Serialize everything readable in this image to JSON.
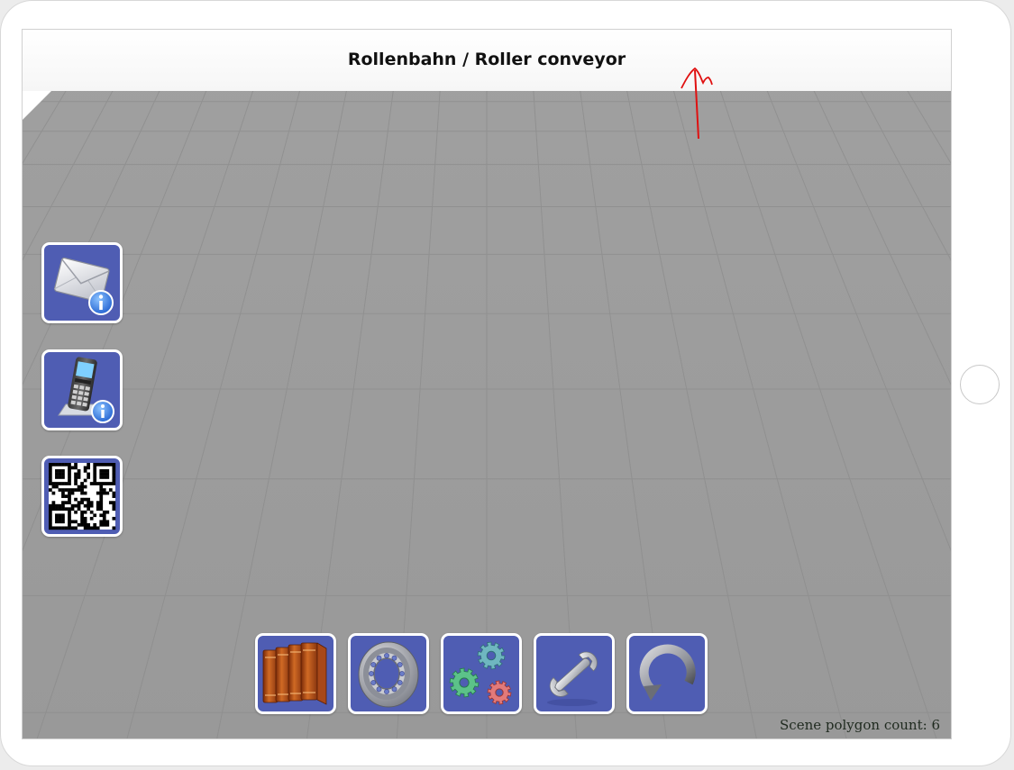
{
  "title": "Rollenbahn / Roller conveyor",
  "status": {
    "polygon_count": "Scene polygon count: 6"
  },
  "colors": {
    "button_bg": "#4f5db3",
    "scene_floor": "#9b9b9b",
    "grid_line": "#8d8d8d",
    "annotation": "#e01010"
  },
  "side_buttons": [
    {
      "name": "mail-info-button",
      "icon": "envelope-info-icon"
    },
    {
      "name": "phone-info-button",
      "icon": "phone-info-icon"
    },
    {
      "name": "qr-code-button",
      "icon": "qr-code-icon"
    }
  ],
  "bottom_buttons": [
    {
      "name": "documentation-button",
      "icon": "books-icon"
    },
    {
      "name": "bearing-button",
      "icon": "ball-bearing-icon"
    },
    {
      "name": "gears-button",
      "icon": "gears-icon"
    },
    {
      "name": "tools-button",
      "icon": "wrench-icon"
    },
    {
      "name": "reset-view-button",
      "icon": "rotate-arrow-icon"
    }
  ]
}
